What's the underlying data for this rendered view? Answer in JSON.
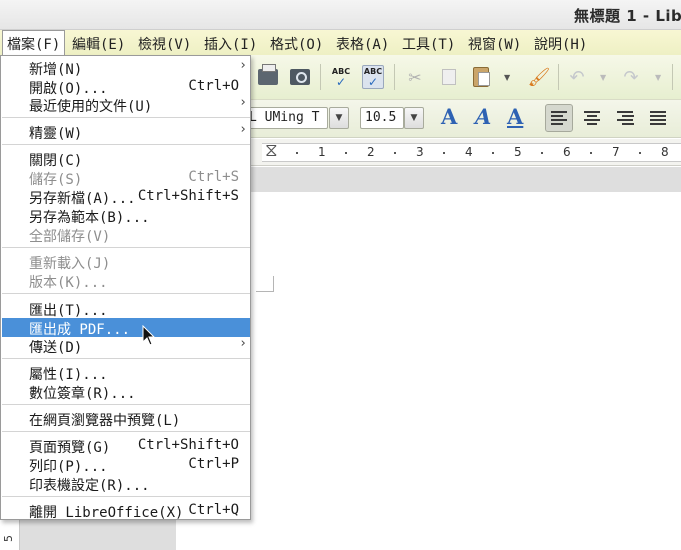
{
  "window": {
    "title": "無標題 1 - Lib"
  },
  "menubar": [
    {
      "label": "檔案(F)",
      "active": true
    },
    {
      "label": "編輯(E)"
    },
    {
      "label": "檢視(V)"
    },
    {
      "label": "插入(I)"
    },
    {
      "label": "格式(O)"
    },
    {
      "label": "表格(A)"
    },
    {
      "label": "工具(T)"
    },
    {
      "label": "視窗(W)"
    },
    {
      "label": "說明(H)"
    }
  ],
  "file_menu": {
    "items": [
      {
        "label": "新增(N)",
        "submenu": true
      },
      {
        "label": "開啟(O)...",
        "shortcut": "Ctrl+O"
      },
      {
        "label": "最近使用的文件(U)",
        "submenu": true
      },
      {
        "label": "精靈(W)",
        "submenu": true
      },
      {
        "label": "關閉(C)"
      },
      {
        "label": "儲存(S)",
        "shortcut": "Ctrl+S",
        "disabled": true
      },
      {
        "label": "另存新檔(A)...",
        "shortcut": "Ctrl+Shift+S"
      },
      {
        "label": "另存為範本(B)..."
      },
      {
        "label": "全部儲存(V)",
        "disabled": true
      },
      {
        "label": "重新載入(J)",
        "disabled": true
      },
      {
        "label": "版本(K)...",
        "disabled": true
      },
      {
        "label": "匯出(T)..."
      },
      {
        "label": "匯出成 PDF...",
        "highlighted": true
      },
      {
        "label": "傳送(D)",
        "submenu": true
      },
      {
        "label": "屬性(I)..."
      },
      {
        "label": "數位簽章(R)..."
      },
      {
        "label": "在網頁瀏覽器中預覽(L)"
      },
      {
        "label": "頁面預覽(G)",
        "shortcut": "Ctrl+Shift+O"
      },
      {
        "label": "列印(P)...",
        "shortcut": "Ctrl+P"
      },
      {
        "label": "印表機設定(R)..."
      },
      {
        "label": "離開 LibreOffice(X)",
        "shortcut": "Ctrl+Q"
      }
    ],
    "submenu_arrow": "›"
  },
  "toolbar": {
    "font_name": "L UMing T",
    "font_size": "10.5",
    "spellcheck_text": "ABC",
    "dropdown_glyph": "▼"
  },
  "ruler": {
    "numbers": [
      "1",
      "2",
      "3",
      "4",
      "5",
      "6",
      "7",
      "8"
    ],
    "vertical_number": "5"
  },
  "colors": {
    "menubar_bg": "#f3f4cc",
    "menu_highlight": "#4a90d9",
    "disabled_text": "#8e8e8e",
    "format_icon_blue": "#2e62b3"
  }
}
